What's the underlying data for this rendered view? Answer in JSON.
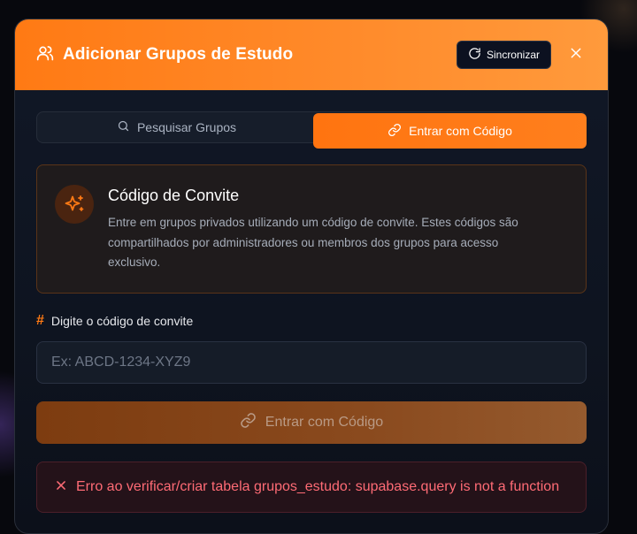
{
  "modal": {
    "title": "Adicionar Grupos de Estudo",
    "sync_label": "Sincronizar"
  },
  "tabs": [
    {
      "label": "Pesquisar Grupos",
      "icon": "search-icon",
      "active": false
    },
    {
      "label": "Entrar com Código",
      "icon": "link-icon",
      "active": true
    }
  ],
  "info": {
    "title": "Código de Convite",
    "description": "Entre em grupos privados utilizando um código de convite. Estes códigos são compartilhados por administradores ou membros dos grupos para acesso exclusivo.",
    "icon": "sparkles-icon"
  },
  "form": {
    "label": "Digite o código de convite",
    "label_icon": "#",
    "placeholder": "Ex: ABCD-1234-XYZ9",
    "value": "",
    "submit_label": "Entrar com Código"
  },
  "error": {
    "message": "Erro ao verificar/criar tabela grupos_estudo: supabase.query is not a function"
  },
  "colors": {
    "accent": "#ff7a14",
    "error": "#ff6b75",
    "background": "#111827"
  }
}
